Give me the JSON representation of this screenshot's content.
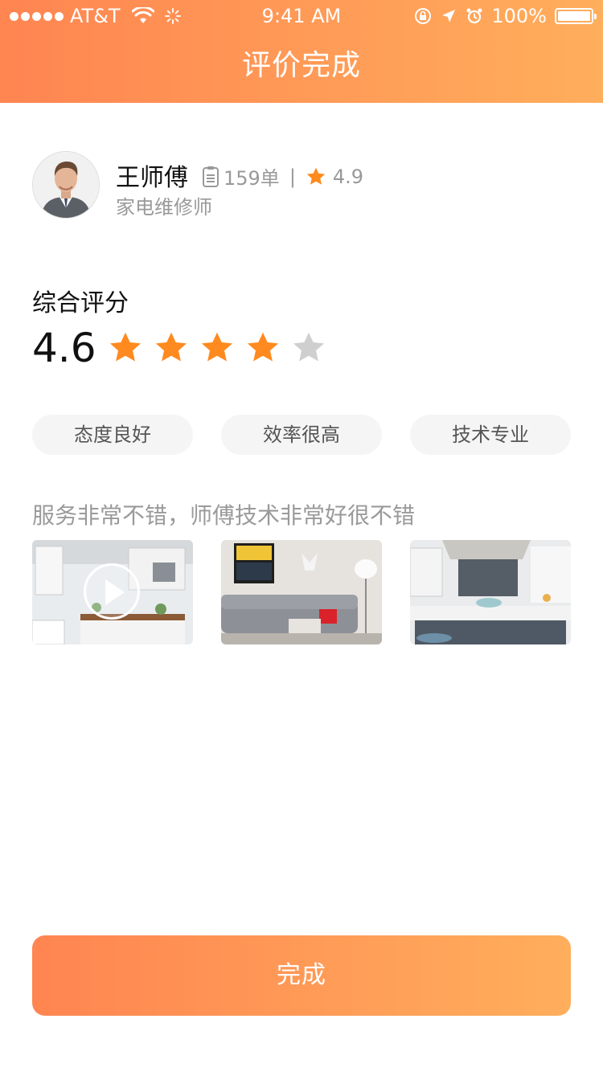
{
  "status_bar": {
    "carrier": "AT&T",
    "time": "9:41 AM",
    "battery": "100%"
  },
  "header": {
    "title": "评价完成"
  },
  "worker": {
    "name": "王师傅",
    "orders": "159单",
    "rating": "4.9",
    "role": "家电维修师"
  },
  "score": {
    "label": "综合评分",
    "value": "4.6",
    "stars_filled": 4,
    "stars_total": 5
  },
  "tags": [
    "态度良好",
    "效率很高",
    "技术专业"
  ],
  "comment": "服务非常不错，师傅技术非常好很不错",
  "photos": [
    {
      "kind": "video",
      "name": "kitchen-video"
    },
    {
      "kind": "image",
      "name": "living-room-photo"
    },
    {
      "kind": "image",
      "name": "kitchen-island-photo"
    }
  ],
  "colors": {
    "gradient_start": "#ff8551",
    "gradient_end": "#ffae5c",
    "star_filled": "#ff8a1f",
    "star_empty": "#cfcfcf"
  },
  "done_button": {
    "label": "完成"
  }
}
